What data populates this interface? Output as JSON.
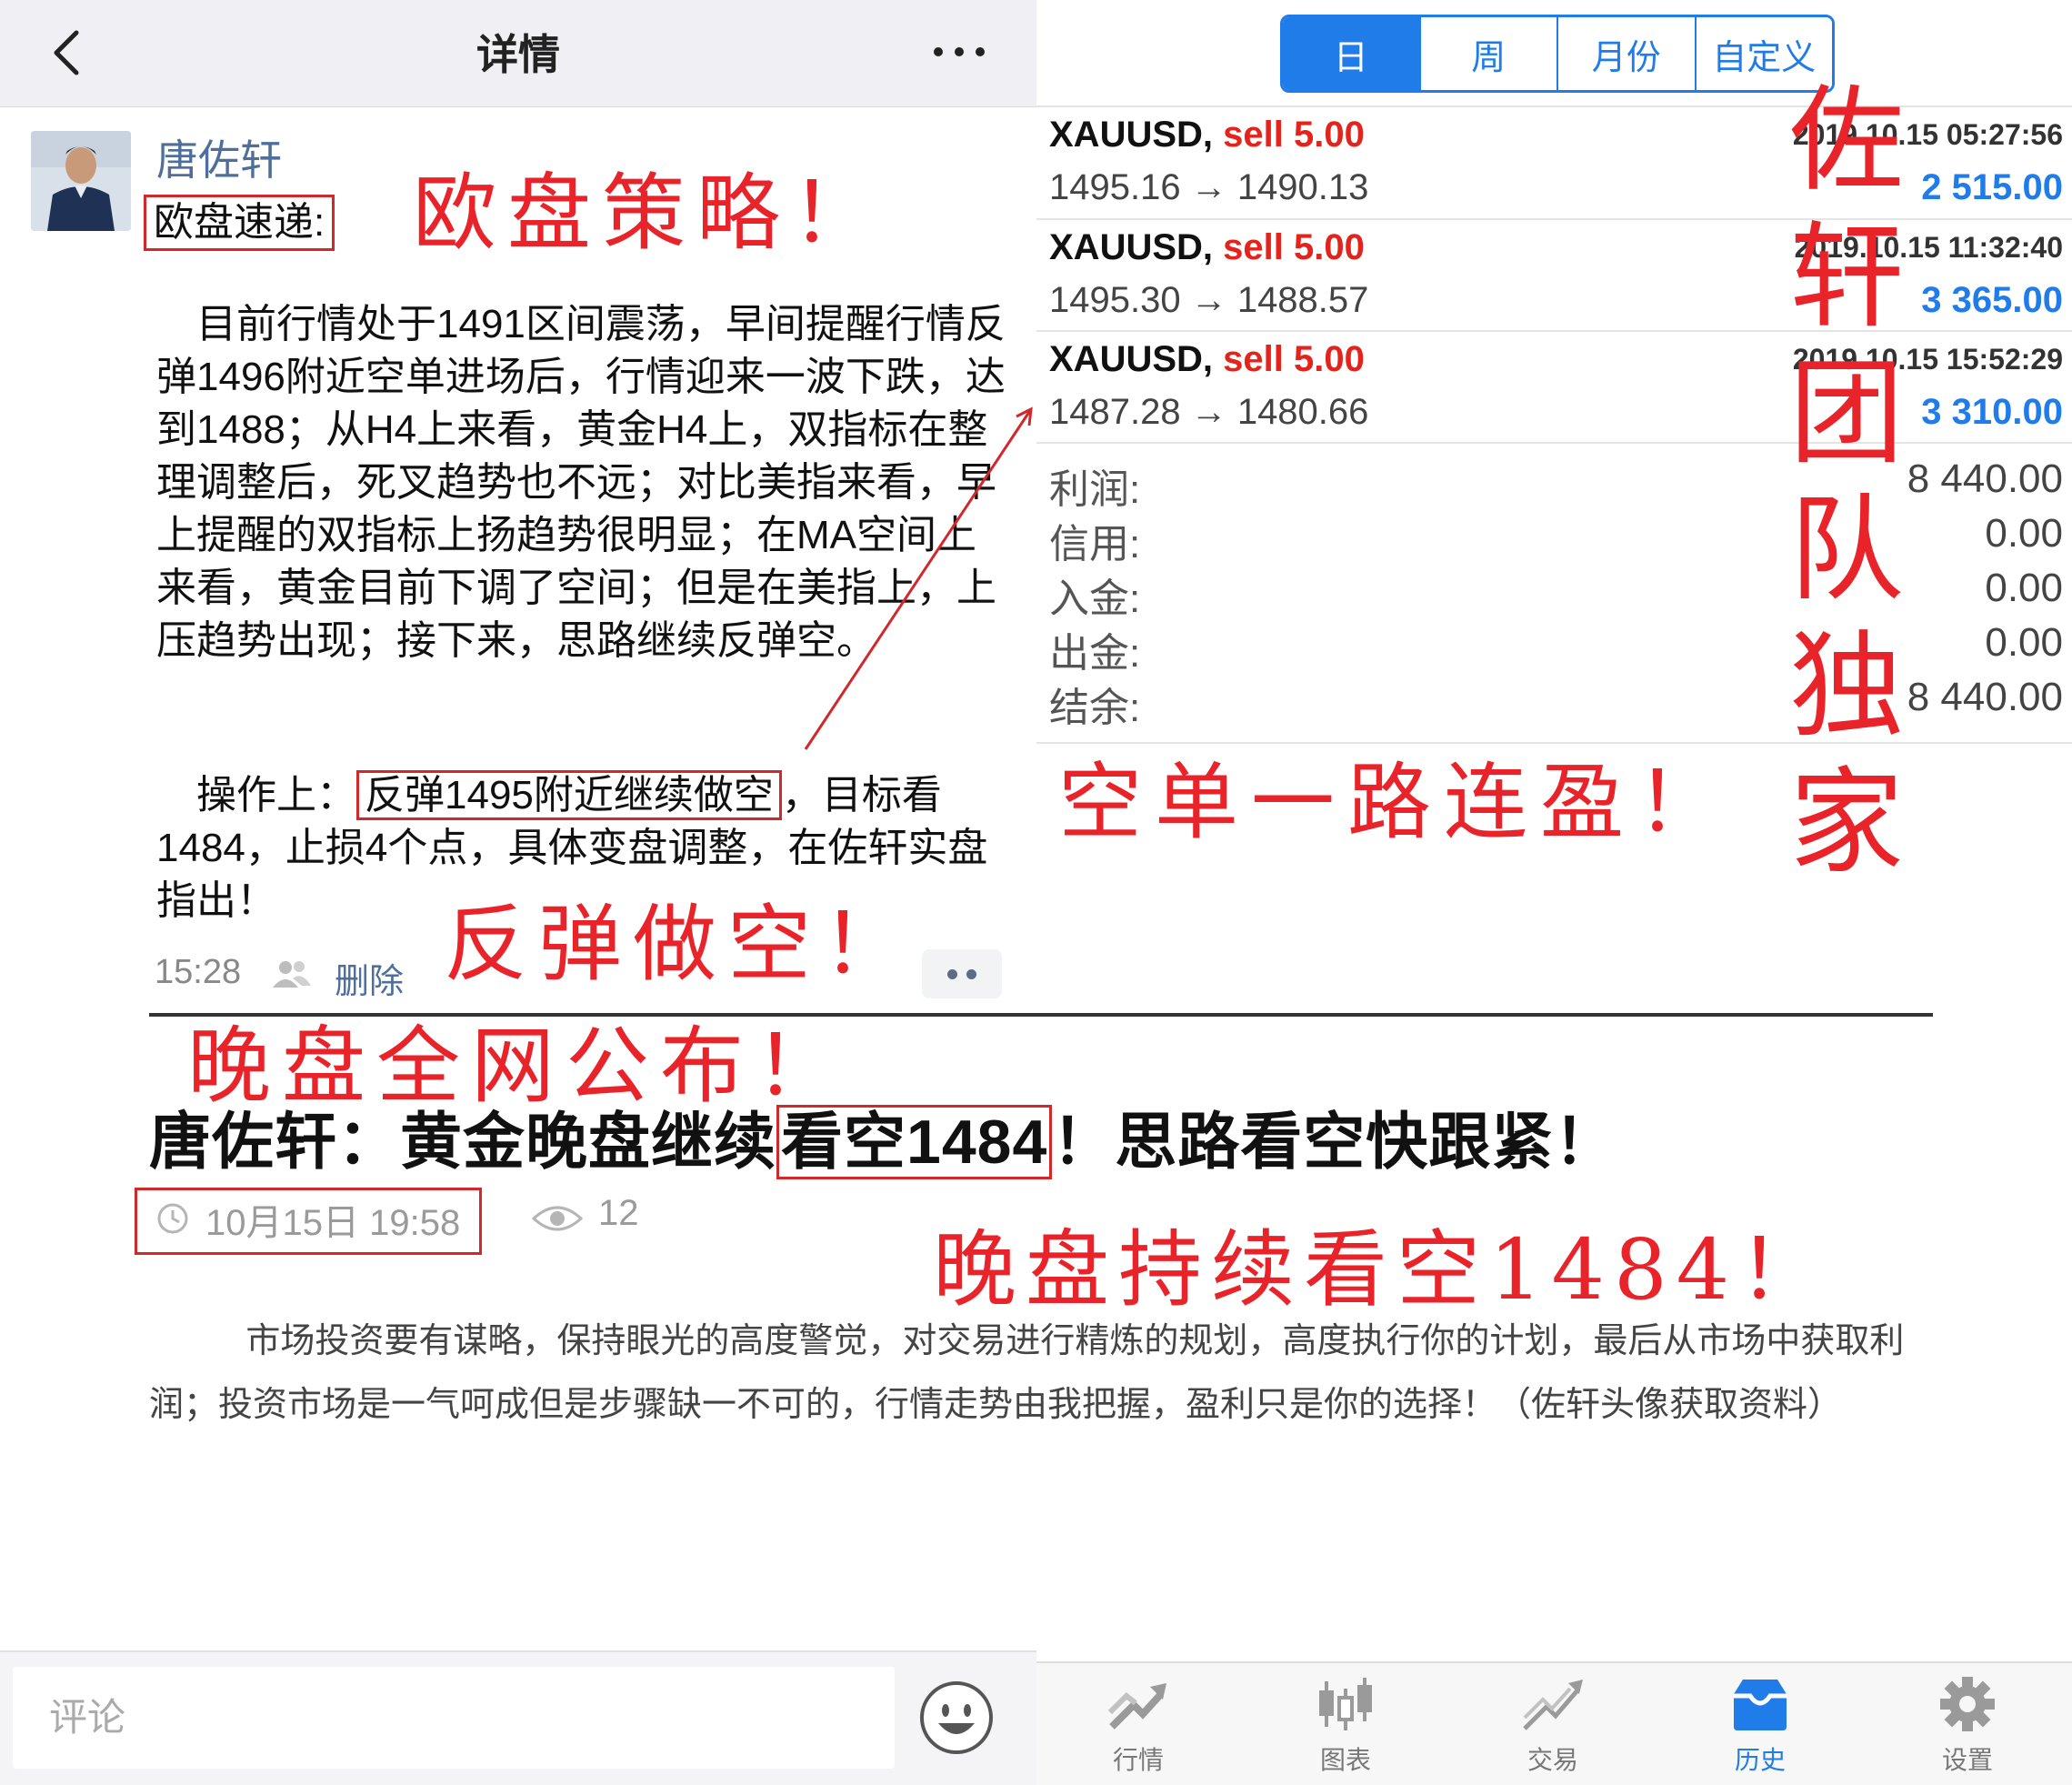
{
  "left": {
    "header": {
      "title": "详情"
    },
    "post": {
      "author": "唐佐轩",
      "subtitle": "欧盘速递:",
      "body": [
        "目前行情处于1491区间震荡，早间提醒行情反弹1496附近空单进场后，行情迎来一波下跌，达到1488；从H4上来看，黄金H4上，双指标在整理调整后，死叉趋势也不远；对比美指来看，早上提醒的双指标上扬趋势很明显；在MA空间上来看，黄金目前下调了空间；但是在美指上，上压趋势出现；接下来，思路继续反弹空。"
      ],
      "operation_prefix": "操作上：",
      "operation_boxed": "反弹1495附近继续做空",
      "operation_suffix": "，目标看1484，止损4个点，具体变盘调整，在佐轩实盘指出！",
      "time": "15:28",
      "delete_label": "删除"
    },
    "comment_bar": {
      "placeholder": "评论"
    }
  },
  "right": {
    "period_tabs": [
      {
        "label": "日",
        "active": true
      },
      {
        "label": "周",
        "active": false
      },
      {
        "label": "月份",
        "active": false
      },
      {
        "label": "自定义",
        "active": false
      }
    ],
    "trades": [
      {
        "symbol": "XAUUSD,",
        "side": "sell 5.00",
        "datetime": "2019.10.15 05:27:56",
        "prices": "1495.16 → 1490.13",
        "profit": "2 515.00"
      },
      {
        "symbol": "XAUUSD,",
        "side": "sell 5.00",
        "datetime": "2019.10.15 11:32:40",
        "prices": "1495.30 → 1488.57",
        "profit": "3 365.00"
      },
      {
        "symbol": "XAUUSD,",
        "side": "sell 5.00",
        "datetime": "2019.10.15 15:52:29",
        "prices": "1487.28 → 1480.66",
        "profit": "3 310.00"
      }
    ],
    "summary": [
      {
        "label": "利润:",
        "value": "8 440.00"
      },
      {
        "label": "信用:",
        "value": "0.00"
      },
      {
        "label": "入金:",
        "value": "0.00"
      },
      {
        "label": "出金:",
        "value": "0.00"
      },
      {
        "label": "结余:",
        "value": "8 440.00"
      }
    ],
    "bottom_tabs": [
      {
        "label": "行情",
        "icon": "quotes-icon",
        "active": false
      },
      {
        "label": "图表",
        "icon": "chart-icon",
        "active": false
      },
      {
        "label": "交易",
        "icon": "trade-icon",
        "active": false
      },
      {
        "label": "历史",
        "icon": "history-icon",
        "active": true
      },
      {
        "label": "设置",
        "icon": "settings-icon",
        "active": false
      }
    ]
  },
  "article": {
    "title_before": "唐佐轩：黄金晚盘继续",
    "title_boxed": "看空1484",
    "title_after": "！思路看空快跟紧！",
    "date": "10月15日 19:58",
    "views": "12",
    "body": "市场投资要有谋略，保持眼光的高度警觉，对交易进行精炼的规划，高度执行你的计划，最后从市场中获取利润；投资市场是一气呵成但是步骤缺一不可的，行情走势由我把握，盈利只是你的选择！（佐轩头像获取资料）"
  },
  "annotations": {
    "strategy": "欧盘策略！",
    "shorts": "空单一路连盈！",
    "rebound": "反弹做空！",
    "published": "晚盘全网公布！",
    "evening": "晚盘持续看空1484！",
    "team": "佐轩团队独家"
  },
  "colors": {
    "accent_blue": "#1f7ce8",
    "annotation_red": "#e8242a",
    "sell_red": "#e3231c",
    "link_blue": "#4f6f9a"
  }
}
